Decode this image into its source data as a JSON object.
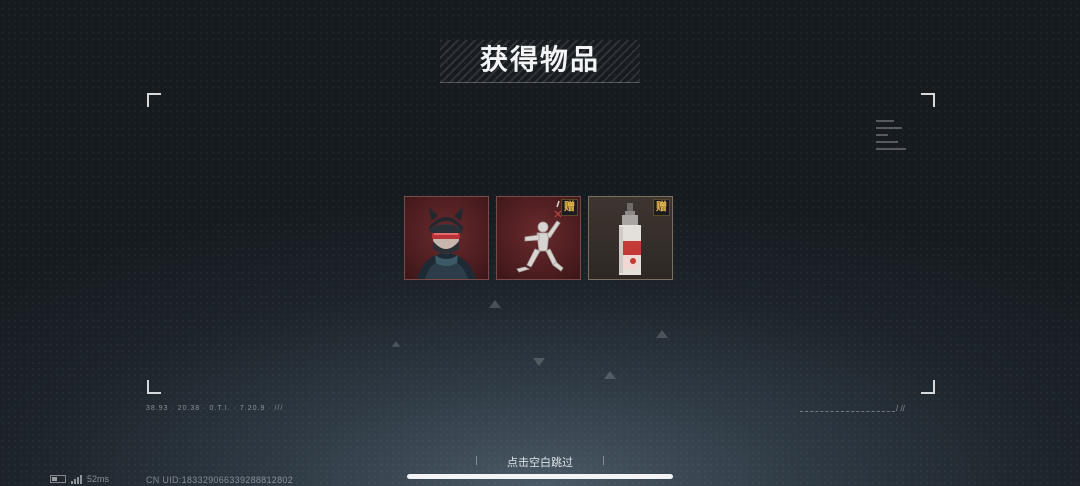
{
  "title": "获得物品",
  "items": [
    {
      "name": "cat-ear-cap-character-portrait",
      "badge": ""
    },
    {
      "name": "dancing-figure-emote",
      "badge": "赠"
    },
    {
      "name": "decorated-bottle-item",
      "badge": "赠"
    }
  ],
  "skip_hint": "点击空白跳过",
  "status": {
    "left_readout": "38.93 · 20.38 · 0.T.I. · 7.20.9 · ///",
    "slashes": "/ //",
    "ping": "52ms",
    "uid": "CN UID:183329066339288812802"
  },
  "colors": {
    "badge_text": "#e4b44c",
    "item_red_bg": "#4a1c1f",
    "item_brown_bg": "#2e2824"
  }
}
